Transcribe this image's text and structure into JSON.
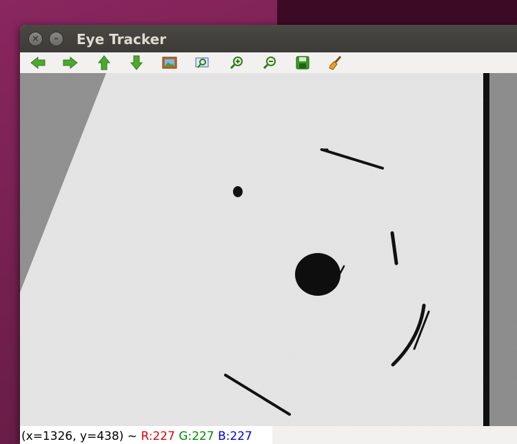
{
  "window": {
    "title": "Eye Tracker"
  },
  "toolbar": {
    "buttons": [
      {
        "name": "pan-left-button",
        "icon": "arrow-left-icon",
        "color": "#4aa02c"
      },
      {
        "name": "pan-right-button",
        "icon": "arrow-right-icon",
        "color": "#4aa02c"
      },
      {
        "name": "pan-up-button",
        "icon": "arrow-up-icon",
        "color": "#4aa02c"
      },
      {
        "name": "pan-down-button",
        "icon": "arrow-down-icon",
        "color": "#4aa02c"
      },
      {
        "name": "zoom-fit-button",
        "icon": "image-icon",
        "color": "#c87a2a"
      },
      {
        "name": "zoom-rect-button",
        "icon": "zoom-area-icon",
        "color": "#3a7ac8"
      },
      {
        "name": "zoom-in-button",
        "icon": "zoom-in-icon",
        "color": "#4aa02c"
      },
      {
        "name": "zoom-out-button",
        "icon": "zoom-out-icon",
        "color": "#4aa02c"
      },
      {
        "name": "save-button",
        "icon": "save-icon",
        "color": "#4aa02c"
      },
      {
        "name": "properties-button",
        "icon": "broom-icon",
        "color": "#d88a20"
      }
    ]
  },
  "status": {
    "coords": "(x=1326, y=438) ~ ",
    "r": "R:227",
    "g": "G:227",
    "b": "B:227"
  }
}
